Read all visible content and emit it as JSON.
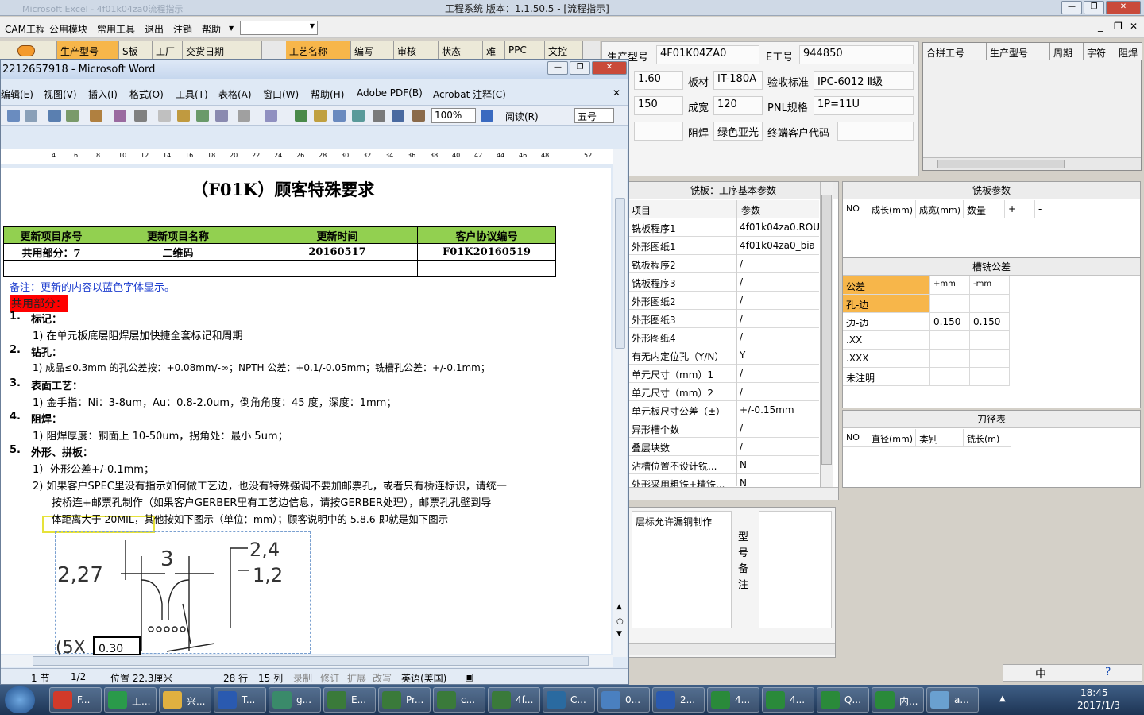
{
  "app_title": "工程系统   版本：1.1.50.5 - [流程指示]",
  "faded_title": "Microsoft Excel - 4f01k04za0流程指示",
  "menu": [
    "CAM工程",
    "公用模块",
    "常用工具",
    "退出",
    "注销",
    "帮助"
  ],
  "top_grid_left": [
    "生产型号",
    "S板",
    "工厂",
    "交货日期"
  ],
  "top_grid_right": [
    "工艺名称",
    "编写",
    "审核",
    "状态",
    "难",
    "PPC",
    "文控"
  ],
  "info": {
    "prod_model_label": "生产型号",
    "prod_model": "4F01K04ZA0",
    "e_no_label": "E工号",
    "e_no": "944850",
    "thickness": "1.60",
    "board_label": "板材",
    "board": "IT-180A",
    "accept_label": "验收标准",
    "accept": "IPC-6012 Ⅱ级",
    "v150": "150",
    "finished_width_label": "成宽",
    "finished_width": "120",
    "pnl_label": "PNL规格",
    "pnl": "1P=11U",
    "mask_label": "阻焊",
    "mask": "绿色亚光",
    "end_customer_label": "终端客户代码"
  },
  "right_grid_headers": [
    "合拼工号",
    "生产型号",
    "周期",
    "字符",
    "阻焊"
  ],
  "mill_panel": {
    "title": "铣板：工序基本参数",
    "col_item": "项目",
    "col_param": "参数",
    "rows": [
      [
        "铣板程序1",
        "4f01k04za0.ROU"
      ],
      [
        "外形图纸1",
        "4f01k04za0_bia"
      ],
      [
        "铣板程序2",
        "/"
      ],
      [
        "铣板程序3",
        "/"
      ],
      [
        "外形图纸2",
        "/"
      ],
      [
        "外形图纸3",
        "/"
      ],
      [
        "外形图纸4",
        "/"
      ],
      [
        "有无内定位孔（Y/N）",
        "Y"
      ],
      [
        "单元尺寸（mm）1",
        "/"
      ],
      [
        "单元尺寸（mm）2",
        "/"
      ],
      [
        "单元板尺寸公差（±）",
        "+/-0.15mm"
      ],
      [
        "异形槽个数",
        "/"
      ],
      [
        "叠层块数",
        "/"
      ],
      [
        "沾槽位置不设计铣...",
        "N"
      ],
      [
        "外形采用粗铣+精铣...",
        "N"
      ]
    ]
  },
  "mill_params": {
    "title": "铣板参数",
    "headers": [
      "NO",
      "成长(mm)",
      "成宽(mm)",
      "数量",
      "+",
      "-"
    ]
  },
  "slot_tol": {
    "title": "槽铣公差",
    "headers": [
      "公差",
      "+mm",
      "-mm"
    ],
    "rows": [
      [
        "孔-边",
        "",
        ""
      ],
      [
        "边-边",
        "0.150",
        "0.150"
      ],
      [
        ".XX",
        "",
        ""
      ],
      [
        ".XXX",
        "",
        ""
      ],
      [
        "未注明",
        "",
        ""
      ]
    ]
  },
  "tool_table": {
    "title": "刀径表",
    "headers": [
      "NO",
      "直径(mm)",
      "类别",
      "铣长(m)"
    ]
  },
  "note_panel": {
    "text": "层标允许漏铜制作",
    "side": [
      "型",
      "号",
      "备",
      "注"
    ]
  },
  "word": {
    "title": "2212657918 - Microsoft Word",
    "menu": [
      "编辑(E)",
      "视图(V)",
      "插入(I)",
      "格式(O)",
      "工具(T)",
      "表格(A)",
      "窗口(W)",
      "帮助(H)",
      "Adobe PDF(B)",
      "Acrobat 注释(C)"
    ],
    "zoom": "100%",
    "read_btn": "阅读(R)",
    "font_size": "五号",
    "ruler_ticks": [
      "4",
      "6",
      "8",
      "10",
      "12",
      "14",
      "16",
      "18",
      "20",
      "22",
      "24",
      "26",
      "28",
      "30",
      "32",
      "34",
      "36",
      "38",
      "40",
      "42",
      "44",
      "46",
      "48",
      "52"
    ],
    "doc_title": "（F01K）顾客特殊要求",
    "table_headers": [
      "更新项目序号",
      "更新项目名称",
      "更新时间",
      "客户协议编号"
    ],
    "table_row": [
      "共用部分：7",
      "二维码",
      "20160517",
      "F01K20160519"
    ],
    "note": "备注：更新的内容以蓝色字体显示。",
    "common": "共用部分：",
    "sections": [
      {
        "n": "1.",
        "h": "标记：",
        "items": [
          "1)  在单元板底层阻焊层加快捷全套标记和周期"
        ]
      },
      {
        "n": "2.",
        "h": "钻孔：",
        "items": [
          "1)  成品≤0.3mm 的孔公差按：+0.08mm/-∞；NPTH 公差：+0.1/-0.05mm；铣槽孔公差：+/-0.1mm；"
        ]
      },
      {
        "n": "3.",
        "h": "表面工艺：",
        "items": [
          "1)  金手指：Ni：3-8um，Au：0.8-2.0um，倒角角度：45 度，深度：1mm；"
        ]
      },
      {
        "n": "4.",
        "h": "阻焊：",
        "items": [
          "1)  阻焊厚度：铜面上 10-50um，拐角处：最小 5um；"
        ]
      },
      {
        "n": "5.",
        "h": "外形、拼板：",
        "items": [
          "外形公差+/-0.1mm；"
        ]
      }
    ],
    "item2_lines": [
      "2)  如果客户SPEC里没有指示如何做工艺边，也没有特殊强调不要加邮票孔，或者只有桥连标识，请统一",
      "按桥连+邮票孔制作（如果客户GERBER里有工艺边信息，请按GERBER处理），邮票孔孔壁到导",
      "体距离大于 20MIL，其他按如下图示（单位：mm）；顾客说明中的 5.8.6 即就是如下图示"
    ],
    "drawing_labels": [
      "2,27",
      "3",
      "2,4",
      "1,2",
      "(5X",
      "0.30"
    ],
    "status": [
      "1 节",
      "1/2",
      "位置 22.3厘米",
      "28 行",
      "15 列",
      "录制",
      "修订",
      "扩展",
      "改写",
      "英语(美国)"
    ]
  },
  "taskbar": {
    "items": [
      "F...",
      "工...",
      "兴...",
      "T...",
      "g...",
      "E...",
      "Pr...",
      "c...",
      "4f...",
      "C...",
      "0...",
      "2...",
      "4...",
      "4...",
      "Q...",
      "内...",
      "a..."
    ],
    "time": "18:45",
    "date": "2017/1/3",
    "ime": "中"
  },
  "colors": {
    "green_header": "#92d050",
    "red_label": "#ff0000",
    "blue_note": "#1f3fcf",
    "orange_sel": "#f7b64a",
    "highlight_box": "#e6e23a"
  }
}
